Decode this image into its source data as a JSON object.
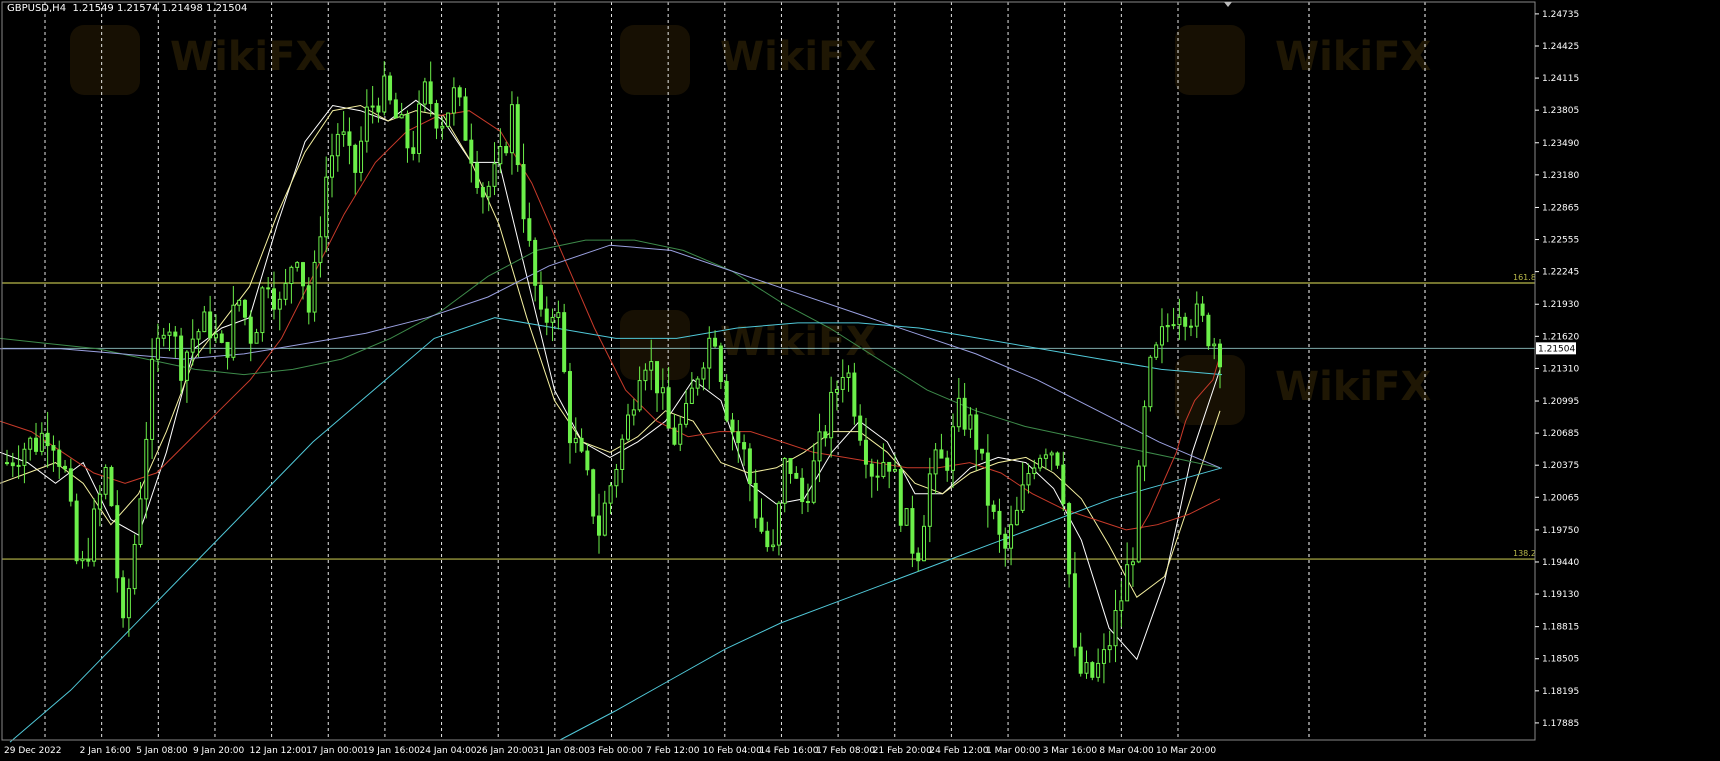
{
  "header": {
    "symbol": "GBPUSD,H4",
    "ohlc": "1.21549 1.21574 1.21498 1.21504"
  },
  "watermark": "WikiFX",
  "colors": {
    "background": "#000000",
    "candle": "#6cf04a",
    "grid": "#ffffff",
    "fib": "#b8b84a",
    "axis": "#ffffff",
    "price_line": "#9fd8d8",
    "ma_white": "#ffffff",
    "ma_yellow": "#f5f0a0",
    "ma_red": "#c83a2a",
    "ma_green": "#3d8a4a",
    "ma_lavender": "#9aa0e0",
    "ma_cyan": "#50c8d8"
  },
  "current_price_label": "1.21504",
  "chart_data": {
    "type": "candlestick",
    "symbol": "GBPUSD",
    "timeframe": "H4",
    "ylim": [
      1.1772,
      1.2485
    ],
    "y_ticks": [
      "1.24735",
      "1.24425",
      "1.24115",
      "1.23805",
      "1.23490",
      "1.23180",
      "1.22865",
      "1.22555",
      "1.22245",
      "1.21930",
      "1.21620",
      "1.21310",
      "1.20995",
      "1.20685",
      "1.20375",
      "1.20065",
      "1.19750",
      "1.19440",
      "1.19130",
      "1.18815",
      "1.18505",
      "1.18195",
      "1.17885"
    ],
    "x_ticks": [
      "29 Dec 2022",
      "2 Jan 16:00",
      "5 Jan 08:00",
      "9 Jan 20:00",
      "12 Jan 12:00",
      "17 Jan 00:00",
      "19 Jan 16:00",
      "24 Jan 04:00",
      "26 Jan 20:00",
      "31 Jan 08:00",
      "3 Feb 00:00",
      "7 Feb 12:00",
      "10 Feb 04:00",
      "14 Feb 16:00",
      "17 Feb 08:00",
      "21 Feb 20:00",
      "24 Feb 12:00",
      "1 Mar 00:00",
      "3 Mar 16:00",
      "8 Mar 04:00",
      "10 Mar 20:00"
    ],
    "fib_levels": [
      {
        "label": "161.8",
        "price": 1.22135
      },
      {
        "label": "138.2",
        "price": 1.19468
      }
    ],
    "current_price": 1.21504,
    "close_path": [
      1.204,
      1.2055,
      1.206,
      1.2075,
      1.203,
      1.1925,
      1.198,
      1.204,
      1.187,
      1.198,
      1.212,
      1.219,
      1.2135,
      1.2165,
      1.2175,
      1.214,
      1.22,
      1.216,
      1.2225,
      1.2185,
      1.2255,
      1.218,
      1.231,
      1.2365,
      1.2315,
      1.238,
      1.24,
      1.237,
      1.234,
      1.24,
      1.237,
      1.2395,
      1.235,
      1.23,
      1.232,
      1.238,
      1.226,
      1.217,
      1.22,
      1.207,
      1.203,
      1.1975,
      1.203,
      1.208,
      1.215,
      1.212,
      1.206,
      1.208,
      1.214,
      1.217,
      1.208,
      1.205,
      1.1985,
      1.1945,
      1.205,
      1.2,
      1.204,
      1.209,
      1.214,
      1.208,
      1.203,
      1.205,
      1.199,
      1.195,
      1.2035,
      1.204,
      1.209,
      1.207,
      1.2,
      1.195,
      1.199,
      1.2045,
      1.206,
      1.2045,
      1.184,
      1.183,
      1.185,
      1.19,
      1.196,
      1.212,
      1.216,
      1.2195,
      1.2185,
      1.217,
      1.215
    ],
    "candle_count": 210,
    "moving_averages": [
      {
        "color": "white",
        "points": [
          1.205,
          1.204,
          1.202,
          1.204,
          1.1985,
          1.197,
          1.205,
          1.215,
          1.217,
          1.218,
          1.227,
          1.235,
          1.2385,
          1.238,
          1.237,
          1.239,
          1.237,
          1.233,
          1.233,
          1.222,
          1.211,
          1.206,
          1.2045,
          1.206,
          1.208,
          1.212,
          1.21,
          1.202,
          1.2,
          1.2005,
          1.205,
          1.208,
          1.206,
          1.201,
          1.201,
          1.2035,
          1.2045,
          1.204,
          1.2015,
          1.1965,
          1.188,
          1.185,
          1.1925,
          1.205,
          1.213
        ]
      },
      {
        "color": "yellow",
        "points": [
          1.202,
          1.203,
          1.204,
          1.202,
          1.198,
          1.201,
          1.207,
          1.214,
          1.2175,
          1.221,
          1.228,
          1.234,
          1.238,
          1.2385,
          1.237,
          1.238,
          1.2375,
          1.233,
          1.227,
          1.218,
          1.21,
          1.206,
          1.205,
          1.2065,
          1.209,
          1.208,
          1.204,
          1.203,
          1.2035,
          1.205,
          1.207,
          1.207,
          1.205,
          1.202,
          1.201,
          1.203,
          1.204,
          1.2045,
          1.203,
          1.2005,
          1.196,
          1.191,
          1.193,
          1.201,
          1.209
        ]
      },
      {
        "color": "red",
        "points": [
          1.208,
          1.207,
          1.205,
          1.203,
          1.202,
          1.203,
          1.206,
          1.209,
          1.212,
          1.216,
          1.222,
          1.228,
          1.233,
          1.236,
          1.2375,
          1.238,
          1.236,
          1.231,
          1.224,
          1.217,
          1.211,
          1.208,
          1.2065,
          1.207,
          1.207,
          1.206,
          1.205,
          1.2045,
          1.204,
          1.2035,
          1.2035,
          1.204,
          1.203,
          1.201,
          1.1995,
          1.1985,
          1.1975,
          1.198,
          1.199,
          1.2005
        ]
      },
      {
        "color": "green",
        "points": [
          1.216,
          1.2155,
          1.215,
          1.214,
          1.213,
          1.2125,
          1.213,
          1.214,
          1.216,
          1.2185,
          1.222,
          1.2245,
          1.2255,
          1.2255,
          1.2245,
          1.2225,
          1.2195,
          1.217,
          1.214,
          1.211,
          1.209,
          1.2075,
          1.2065,
          1.2055,
          1.2045,
          1.2035
        ]
      },
      {
        "color": "lavender",
        "points": [
          1.215,
          1.215,
          1.2145,
          1.214,
          1.2145,
          1.2155,
          1.2165,
          1.218,
          1.22,
          1.223,
          1.225,
          1.2245,
          1.2225,
          1.2205,
          1.2185,
          1.2165,
          1.2145,
          1.212,
          1.209,
          1.206,
          1.2035
        ]
      },
      {
        "color": "cyan",
        "points": [
          1.177,
          1.182,
          1.188,
          1.194,
          1.2,
          1.206,
          1.211,
          1.216,
          1.218,
          1.217,
          1.216,
          1.216,
          1.217,
          1.2175,
          1.2175,
          1.217,
          1.216,
          1.215,
          1.214,
          1.213,
          1.2125
        ]
      },
      {
        "color": "cyan",
        "points": [
          1.1772,
          1.18,
          1.183,
          1.186,
          1.1885,
          1.1905,
          1.1925,
          1.1945,
          1.1965,
          1.1985,
          1.2005,
          1.202,
          1.2035
        ]
      },
      {
        "color": "red",
        "points": [
          1.1975,
          1.199,
          1.201,
          1.203,
          1.205,
          1.208,
          1.21,
          1.211,
          1.212,
          1.215
        ]
      }
    ]
  }
}
